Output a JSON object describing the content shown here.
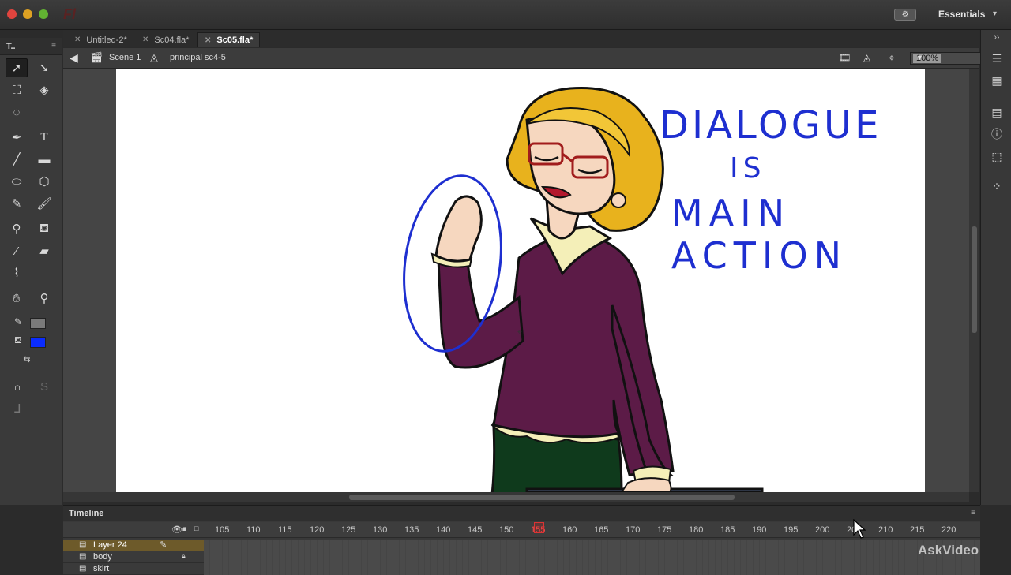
{
  "window": {
    "workspace_label": "Essentials",
    "app_logo": "Fl"
  },
  "tabs": [
    {
      "label": "Untitled-2*",
      "active": false
    },
    {
      "label": "Sc04.fla*",
      "active": false
    },
    {
      "label": "Sc05.fla*",
      "active": true
    }
  ],
  "editbar": {
    "scene": "Scene 1",
    "symbol": "principal sc4-5",
    "zoom": "100%"
  },
  "tools_panel": {
    "title": "T..",
    "stroke_color": "#7a7a7a",
    "fill_color": "#0a2cff"
  },
  "stage": {
    "annotation_lines": [
      "DIALOGUE",
      "IS",
      "MAIN ACTION"
    ],
    "annotation_color": "#1e2fd0"
  },
  "timeline": {
    "title": "Timeline",
    "frame_numbers": [
      "105",
      "110",
      "115",
      "120",
      "125",
      "130",
      "135",
      "140",
      "145",
      "150",
      "155",
      "160",
      "165",
      "170",
      "175",
      "180",
      "185",
      "190",
      "195",
      "200",
      "205",
      "210",
      "215",
      "220"
    ],
    "current_frame": "155",
    "layers": [
      {
        "name": "Layer 24",
        "selected": true
      },
      {
        "name": "body",
        "selected": false
      },
      {
        "name": "skirt",
        "selected": false
      }
    ]
  },
  "watermark": "AskVideo"
}
